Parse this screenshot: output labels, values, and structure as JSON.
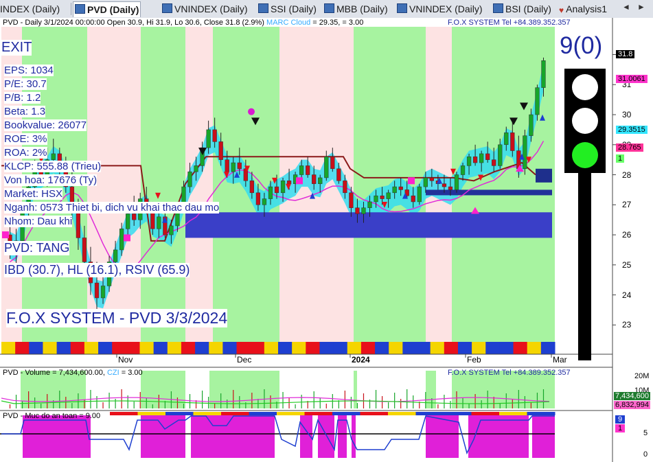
{
  "tabs": [
    {
      "label": "INDEX (Daily)",
      "active": false
    },
    {
      "label": "PVD (Daily)",
      "active": true
    },
    {
      "label": "VNINDEX (Daily)",
      "active": false
    },
    {
      "label": "SSI (Daily)",
      "active": false
    },
    {
      "label": "MBB (Daily)",
      "active": false
    },
    {
      "label": "VNINDEX (Daily)",
      "active": false
    },
    {
      "label": "BSI (Daily)",
      "active": false
    },
    {
      "label": "Analysis1",
      "active": false
    }
  ],
  "main_pane": {
    "header_left": "PVD - Daily 3/1/2024 00:00:00 Open 30.9, Hi 31.9, Lo 30.6, Close 31.8 (2.9%)",
    "header_marc": "MARC Cloud",
    "header_marc_value": "= 29.35,",
    "header_extra": "= 3.00",
    "header_right": "F.O.X SYSTEM Tel +84.389.352.357",
    "signal": "EXIT",
    "stats": [
      "EPS: 1034",
      "P/E: 30.7",
      "P/B: 1.2",
      "Beta: 1.3",
      "Bookvalue: 26077",
      "ROE: 3%",
      "ROA: 2%",
      "KLCP: 555.88 (Trieu)",
      "Von hoa: 17676 (Ty)",
      "Market: HSX",
      "Nganh: 0573 Thiet bi, dich vu khai thac dau mo",
      "Nhom: Dau khi"
    ],
    "trend": "PVD: TANG",
    "indicators": "IBD (30.7), HL (16.1), RSIV (65.9)",
    "footer_title": "F.O.X SYSTEM - PVD 3/3/2024",
    "score": "9(0)",
    "price_axis": [
      "32",
      "31",
      "30",
      "29",
      "28",
      "27",
      "26",
      "25",
      "24",
      "23"
    ],
    "price_labels": [
      {
        "text": "31.8",
        "bg": "#000000",
        "fg": "#ffffff"
      },
      {
        "text": "31.0061",
        "bg": "#ff33cc",
        "fg": "#000000"
      },
      {
        "text": "29.3515",
        "bg": "#33e6ff",
        "fg": "#000000"
      },
      {
        "text": "28.765",
        "bg": "#ff3399",
        "fg": "#000000"
      },
      {
        "text": "1",
        "bg": "#66ff66",
        "fg": "#000000"
      }
    ],
    "x_axis": [
      "Nov",
      "Dec",
      "2024",
      "Feb",
      "Mar"
    ]
  },
  "volume_pane": {
    "header_left": "PVD - Volume = 7,434,600.00,",
    "header_czi": "CZI",
    "header_czi_value": "= 3.00",
    "header_right": "F.O.X SYSTEM Tel +84.389.352.357",
    "axis": [
      "20M",
      "10M"
    ],
    "labels": [
      {
        "text": "7,434,600",
        "bg": "#1e7b2e",
        "fg": "#ffffff"
      },
      {
        "text": "6,832,994",
        "bg": "#ff66cc",
        "fg": "#000000"
      }
    ]
  },
  "safety_pane": {
    "header_left": "PVD - Muc do an toan = 9.00",
    "axis": [
      "5",
      "0"
    ],
    "labels": [
      {
        "text": "9",
        "bg": "#1e3fd0",
        "fg": "#ffffff"
      },
      {
        "text": "1",
        "bg": "#ff33cc",
        "fg": "#000000"
      }
    ]
  },
  "chart_data": {
    "type": "candlestick",
    "ylim": [
      22.3,
      32.4
    ],
    "candles": [
      [
        26.0,
        26.5,
        25.2,
        25.5
      ],
      [
        25.5,
        26.2,
        24.6,
        25.8
      ],
      [
        25.8,
        27.0,
        25.6,
        26.8
      ],
      [
        26.8,
        28.0,
        26.5,
        27.6
      ],
      [
        27.6,
        28.5,
        27.2,
        28.2
      ],
      [
        28.2,
        28.7,
        27.8,
        28.0
      ],
      [
        28.0,
        28.9,
        27.6,
        28.5
      ],
      [
        28.5,
        29.2,
        28.1,
        28.7
      ],
      [
        28.7,
        28.9,
        28.0,
        28.2
      ],
      [
        28.2,
        28.6,
        27.4,
        27.6
      ],
      [
        27.6,
        28.1,
        26.5,
        26.8
      ],
      [
        26.8,
        27.2,
        25.5,
        25.9
      ],
      [
        25.9,
        26.3,
        24.9,
        25.1
      ],
      [
        25.1,
        25.6,
        24.0,
        24.4
      ],
      [
        24.4,
        25.1,
        23.5,
        23.9
      ],
      [
        23.9,
        24.6,
        23.7,
        24.3
      ],
      [
        24.3,
        25.3,
        24.1,
        25.1
      ],
      [
        25.1,
        25.8,
        24.8,
        25.5
      ],
      [
        25.5,
        26.4,
        25.3,
        26.2
      ],
      [
        26.2,
        27.0,
        26.0,
        26.7
      ],
      [
        26.7,
        27.3,
        26.3,
        26.5
      ],
      [
        26.5,
        27.4,
        26.2,
        27.2
      ],
      [
        27.2,
        27.6,
        26.7,
        26.8
      ],
      [
        26.8,
        27.1,
        26.0,
        26.2
      ],
      [
        26.2,
        26.8,
        25.9,
        26.6
      ],
      [
        26.6,
        27.0,
        25.9,
        26.0
      ],
      [
        26.0,
        26.5,
        25.7,
        26.3
      ],
      [
        26.3,
        27.1,
        26.1,
        27.0
      ],
      [
        27.0,
        27.8,
        26.8,
        27.6
      ],
      [
        27.6,
        28.4,
        27.4,
        28.1
      ],
      [
        28.1,
        28.6,
        27.8,
        28.3
      ],
      [
        28.3,
        29.1,
        28.1,
        28.9
      ],
      [
        28.9,
        29.8,
        28.7,
        29.5
      ],
      [
        29.5,
        29.9,
        28.9,
        29.1
      ],
      [
        29.1,
        29.4,
        28.3,
        28.5
      ],
      [
        28.5,
        28.8,
        27.9,
        28.1
      ],
      [
        28.1,
        28.6,
        27.7,
        28.4
      ],
      [
        28.4,
        28.9,
        28.0,
        28.2
      ],
      [
        28.2,
        28.5,
        27.6,
        27.8
      ],
      [
        27.8,
        28.1,
        27.2,
        27.4
      ],
      [
        27.4,
        27.7,
        26.8,
        27.0
      ],
      [
        27.0,
        27.4,
        26.6,
        27.2
      ],
      [
        27.2,
        27.8,
        27.0,
        27.6
      ],
      [
        27.6,
        28.0,
        27.2,
        27.4
      ],
      [
        27.4,
        27.9,
        27.1,
        27.8
      ],
      [
        27.8,
        28.2,
        27.5,
        27.7
      ],
      [
        27.7,
        28.1,
        27.4,
        28.0
      ],
      [
        28.0,
        28.5,
        27.8,
        28.3
      ],
      [
        28.3,
        28.6,
        27.9,
        28.0
      ],
      [
        28.0,
        28.3,
        27.5,
        27.7
      ],
      [
        27.7,
        28.0,
        27.4,
        27.9
      ],
      [
        27.9,
        28.8,
        27.8,
        28.6
      ],
      [
        28.6,
        28.9,
        28.1,
        28.2
      ],
      [
        28.2,
        28.4,
        27.7,
        27.8
      ],
      [
        27.8,
        28.0,
        27.2,
        27.4
      ],
      [
        27.4,
        27.6,
        26.6,
        26.9
      ],
      [
        26.9,
        27.2,
        26.4,
        26.7
      ],
      [
        26.7,
        27.1,
        26.4,
        26.9
      ],
      [
        26.9,
        27.3,
        26.6,
        27.1
      ],
      [
        27.1,
        27.5,
        26.9,
        27.3
      ],
      [
        27.3,
        27.6,
        27.0,
        27.2
      ],
      [
        27.2,
        27.5,
        26.9,
        27.4
      ],
      [
        27.4,
        27.8,
        27.2,
        27.6
      ],
      [
        27.6,
        27.9,
        27.3,
        27.5
      ],
      [
        27.5,
        27.8,
        27.2,
        27.3
      ],
      [
        27.3,
        27.6,
        26.9,
        27.1
      ],
      [
        27.1,
        27.7,
        27.0,
        27.6
      ],
      [
        27.6,
        28.1,
        27.4,
        27.9
      ],
      [
        27.9,
        28.2,
        27.6,
        27.8
      ],
      [
        27.8,
        28.0,
        27.5,
        27.7
      ],
      [
        27.7,
        28.0,
        27.4,
        27.6
      ],
      [
        27.6,
        27.9,
        27.3,
        27.5
      ],
      [
        27.5,
        28.1,
        27.4,
        28.0
      ],
      [
        28.0,
        28.4,
        27.8,
        28.3
      ],
      [
        28.3,
        28.7,
        28.0,
        28.6
      ],
      [
        28.6,
        29.0,
        28.3,
        28.4
      ],
      [
        28.4,
        28.8,
        28.1,
        28.7
      ],
      [
        28.7,
        29.1,
        28.4,
        28.5
      ],
      [
        28.5,
        28.9,
        28.1,
        28.3
      ],
      [
        28.3,
        29.2,
        28.2,
        29.0
      ],
      [
        29.0,
        29.6,
        28.8,
        29.4
      ],
      [
        29.4,
        29.8,
        28.6,
        28.8
      ],
      [
        28.8,
        29.3,
        27.9,
        28.2
      ],
      [
        28.2,
        29.5,
        28.0,
        29.3
      ],
      [
        29.3,
        30.2,
        29.1,
        30.0
      ],
      [
        30.0,
        31.0,
        29.8,
        30.9
      ],
      [
        30.9,
        31.9,
        30.6,
        31.8
      ]
    ]
  }
}
